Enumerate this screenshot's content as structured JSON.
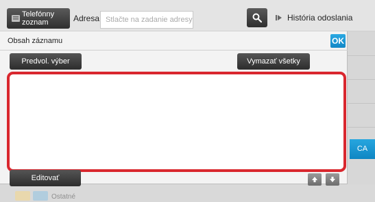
{
  "topbar": {
    "phonebook_label": "Telefónny\nzoznam",
    "address_label": "Adresa",
    "address_placeholder": "Stlačte na zadanie adresy",
    "history_label": "História odoslania"
  },
  "dialog": {
    "title": "Obsah záznamu",
    "ok_label": "OK",
    "preset_label": "Predvol. výber",
    "clear_all_label": "Vymazať všetky",
    "edit_label": "Editovať"
  },
  "side": {
    "ca_label": "CA"
  },
  "background": {
    "other_label": "Ostatné"
  },
  "colors": {
    "accent": "#1a95d2",
    "highlight": "#d9272e"
  }
}
